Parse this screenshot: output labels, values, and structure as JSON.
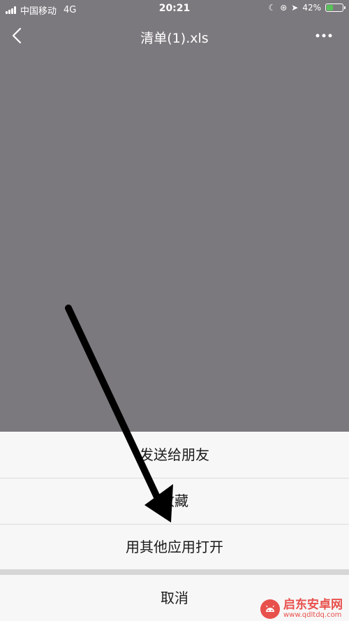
{
  "statusbar": {
    "carrier": "中国移动",
    "network": "4G",
    "time": "20:21",
    "battery": "42%",
    "battery_level": 0.42
  },
  "navbar": {
    "title": "清单(1).xls"
  },
  "action_sheet": {
    "options": [
      {
        "label": "发送给朋友"
      },
      {
        "label": "收藏"
      },
      {
        "label": "用其他应用打开"
      }
    ],
    "cancel": "取消"
  },
  "watermark": {
    "brand": "启东安卓网",
    "url": "www.qdltdq.com"
  },
  "colors": {
    "overlay_bg": "#7c797e",
    "sheet_bg": "#f7f7f7",
    "battery_fill": "#58c25a",
    "watermark": "#e8504c"
  }
}
